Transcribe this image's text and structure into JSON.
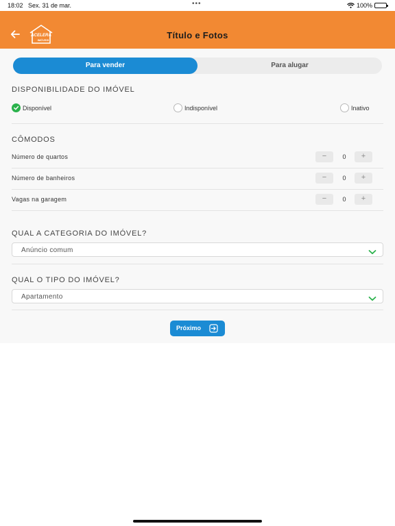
{
  "status_bar": {
    "time": "18:02",
    "date": "Sex. 31 de mar.",
    "more_dots": "•••",
    "battery": "100%",
    "wifi_icon": "wifi-icon",
    "battery_icon": "battery-icon"
  },
  "header": {
    "title": "Título e Fotos",
    "back_icon": "arrow-left-icon",
    "logo_icon": "house-logo-icon",
    "logo_text_top": "ACELERA",
    "logo_text_bottom": "IMÓVEIS",
    "background": "#f28933"
  },
  "tabs": [
    {
      "label": "Para vender",
      "active": true
    },
    {
      "label": "Para alugar",
      "active": false
    }
  ],
  "availability": {
    "title": "DISPONIBILIDADE DO IMÓVEL",
    "options": [
      {
        "label": "Disponível",
        "checked": true
      },
      {
        "label": "Indisponível",
        "checked": false
      },
      {
        "label": "Inativo",
        "checked": false
      }
    ]
  },
  "rooms": {
    "title": "CÔMODOS",
    "items": [
      {
        "label": "Número de quartos",
        "value": "0",
        "minus": "−",
        "plus": "+"
      },
      {
        "label": "Número de banheiros",
        "value": "0",
        "minus": "−",
        "plus": "+"
      },
      {
        "label": "Vagas na garagem",
        "value": "0",
        "minus": "−",
        "plus": "+"
      }
    ]
  },
  "category": {
    "title": "QUAL A CATEGORIA DO IMÓVEL?",
    "selected": "Anúncio comum"
  },
  "type": {
    "title": "QUAL O TIPO DO IMÓVEL?",
    "selected": "Apartamento"
  },
  "next_button": {
    "label": "Próximo",
    "icon": "arrow-right-square-icon"
  },
  "colors": {
    "accent_blue": "#1b8bd4",
    "check_green": "#2bb24c",
    "chevron_green": "#2bb24c"
  }
}
